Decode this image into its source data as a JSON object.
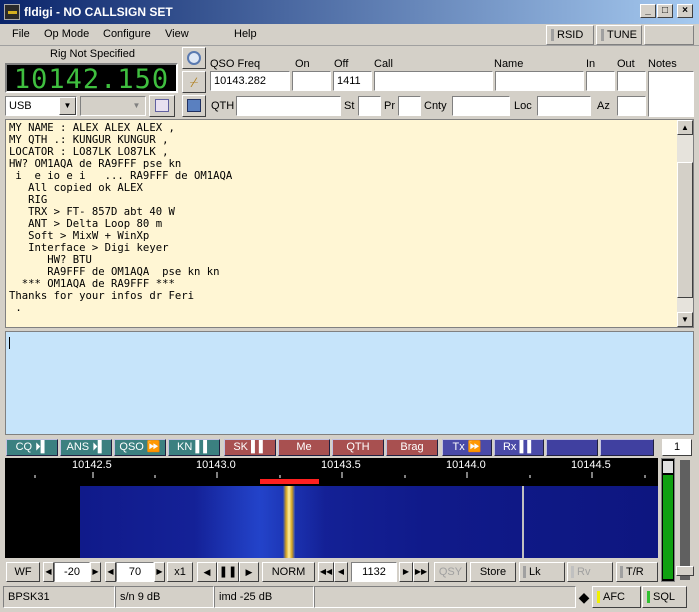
{
  "window": {
    "title": "fldigi - NO CALLSIGN SET"
  },
  "menu": {
    "items": [
      "File",
      "Op Mode",
      "Configure",
      "View",
      "Help"
    ],
    "rsid_label": "RSID",
    "tune_label": "TUNE"
  },
  "rig": {
    "name": "Rig Not Specified",
    "frequency": "10142.150",
    "mode": "USB"
  },
  "log": {
    "qso_freq_label": "QSO Freq",
    "qso_freq": "10143.282",
    "on_label": "On",
    "on": "",
    "off_label": "Off",
    "off": "1411",
    "call_label": "Call",
    "call": "",
    "name_label": "Name",
    "name": "",
    "in_label": "In",
    "in": "",
    "out_label": "Out",
    "out": "",
    "notes_label": "Notes",
    "qth_label": "QTH",
    "st_label": "St",
    "pr_label": "Pr",
    "cnty_label": "Cnty",
    "loc_label": "Loc",
    "az_label": "Az"
  },
  "rx_text": "MY NAME : ALEX ALEX ALEX ,\nMY QTH .: KUNGUR KUNGUR ,\nLOCATOR : LO87LK LO87LK ,\nHW? OM1AQA de RA9FFF pse kn\n i  e io e i   ... RA9FFF de OM1AQA\n   All copied ok ALEX\n   RIG\n   TRX > FT- 857D abt 40 W\n   ANT > Delta Loop 80 m\n   Soft > MixW + WinXp\n   Interface > Digi keyer\n      HW? BTU\n      RA9FFF de OM1AQA  pse kn kn\n  *** OM1AQA de RA9FFF ***\nThanks for your infos dr Feri\n .",
  "macros": [
    {
      "label": "CQ ⏵▌",
      "color": "green"
    },
    {
      "label": "ANS ⏵▌",
      "color": "green"
    },
    {
      "label": "QSO ⏩",
      "color": "green"
    },
    {
      "label": "KN ▌▌",
      "color": "green"
    },
    {
      "label": "SK ▌▌",
      "color": "red"
    },
    {
      "label": "Me",
      "color": "red"
    },
    {
      "label": "QTH",
      "color": "red"
    },
    {
      "label": "Brag",
      "color": "red"
    },
    {
      "label": "Tx ⏩",
      "color": "blue"
    },
    {
      "label": "Rx ▌▌",
      "color": "blue"
    },
    {
      "label": "",
      "color": "blue"
    },
    {
      "label": "",
      "color": "blue"
    }
  ],
  "macro_page": "1",
  "scale": {
    "ticks": [
      "10142.5",
      "10143.0",
      "10143.5",
      "10144.0",
      "10144.5"
    ]
  },
  "controls": {
    "wf_label": "WF",
    "ref_level": "-20",
    "range": "70",
    "zoom": "x1",
    "norm_label": "NORM",
    "carrier": "1132",
    "qsy_label": "QSY",
    "store_label": "Store",
    "lk_label": "Lk",
    "rv_label": "Rv",
    "tr_label": "T/R"
  },
  "status": {
    "mode": "BPSK31",
    "sn": "s/n  9 dB",
    "imd": "imd -25 dB",
    "afc_label": "AFC",
    "sql_label": "SQL"
  },
  "colors": {
    "freq_digits": "#3fbf3f",
    "rx_bg": "#fff6d4",
    "tx_bg": "#c6e4fa",
    "afc_led": "#f0f000",
    "sql_led": "#30c030"
  }
}
